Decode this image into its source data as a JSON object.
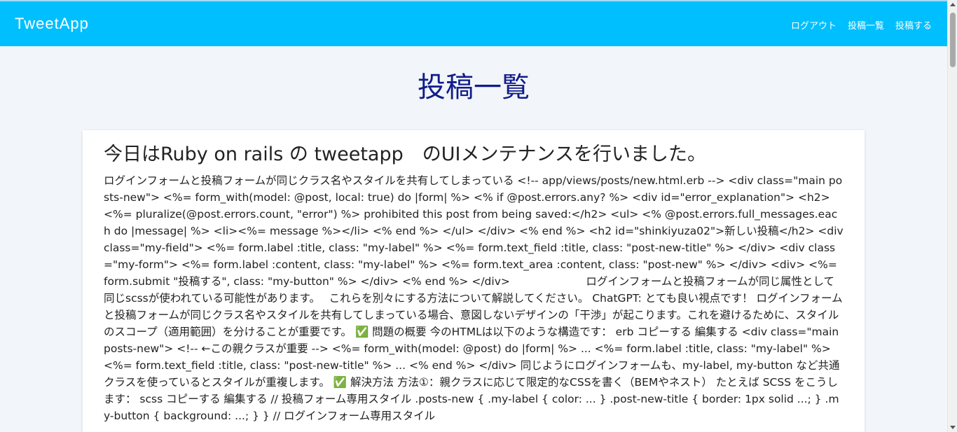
{
  "header": {
    "brand": "TweetApp",
    "nav": [
      "ログアウト",
      "投稿一覧",
      "投稿する"
    ]
  },
  "main": {
    "title": "投稿一覧",
    "post": {
      "title": "今日はRuby on rails の tweetapp　のUIメンテナンスを行いました。",
      "body": "ログインフォームと投稿フォームが同じクラス名やスタイルを共有してしまっている <!-- app/views/posts/new.html.erb --> <div class=\"main posts-new\"> <%= form_with(model: @post, local: true) do |form| %> <% if @post.errors.any? %> <div id=\"error_explanation\"> <h2><%= pluralize(@post.errors.count, \"error\") %> prohibited this post from being saved:</h2> <ul> <% @post.errors.full_messages.each do |message| %> <li><%= message %></li> <% end %> </ul> </div> <% end %> <h2 id=\"shinkiyuza02\">新しい投稿</h2> <div class=\"my-field\"> <%= form.label :title, class: \"my-label\" %> <%= form.text_field :title, class: \"post-new-title\" %> </div> <div class=\"my-form\"> <%= form.label :content, class: \"my-label\" %> <%= form.text_area :content, class: \"post-new\" %> </div> <div> <%= form.submit \"投稿する\", class: \"my-button\" %> </div> <% end %> </div>　　　　　　　ログインフォームと投稿フォームが同じ属性として同じscssが使われている可能性があります。　 これらを別々にする方法について解説してください。 ChatGPT: とても良い視点です！ ログインフォームと投稿フォームが同じクラス名やスタイルを共有してしまっている場合、意図しないデザインの「干渉」が起こります。これを避けるために、スタイルのスコープ（適用範囲）を分けることが重要です。 ✅ 問題の概要 今のHTMLは以下のような構造です： erb コピーする 編集する <div class=\"main posts-new\"> <!-- ←この親クラスが重要 --> <%= form_with(model: @post) do |form| %> ... <%= form.label :title, class: \"my-label\" %> <%= form.text_field :title, class: \"post-new-title\" %> ... <% end %> </div> 同じようにログインフォームも、my-label, my-button など共通クラスを使っているとスタイルが重複します。 ✅ 解決方法 方法①：親クラスに応じて限定的なCSSを書く（BEMやネスト） たとえば SCSS をこうします： scss コピーする 編集する // 投稿フォーム専用スタイル .posts-new { .my-label { color: ... } .post-new-title { border: 1px solid ...; } .my-button { background: ...; } } // ログインフォーム専用スタイル"
    }
  }
}
